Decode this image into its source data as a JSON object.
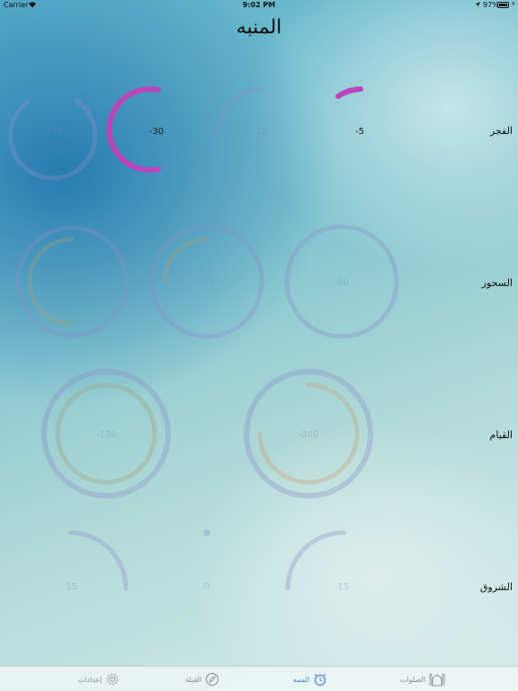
{
  "status_bar": {
    "carrier": "Carrier",
    "time": "9:02 PM",
    "battery": "97%"
  },
  "header": {
    "title": "المنبه"
  },
  "rows": [
    {
      "label": "الفجر",
      "rings": [
        "-45",
        "-30",
        "-15",
        "-5"
      ]
    },
    {
      "label": "السحور",
      "rings": [
        "-90",
        "-25",
        "-60"
      ]
    },
    {
      "label": "القيام",
      "rings": [
        "-120",
        "-300"
      ]
    },
    {
      "label": "الشروق",
      "rings": [
        "15",
        "0",
        "-15"
      ]
    }
  ],
  "tab_bar": {
    "tabs": [
      {
        "label": "إعدادات",
        "icon": "gear-icon"
      },
      {
        "label": "القبلة",
        "icon": "compass-icon"
      },
      {
        "label": "المنبه",
        "icon": "alarm-clock-icon",
        "active": true
      },
      {
        "label": "الصلوات",
        "icon": "mosque-icon"
      }
    ]
  },
  "colors": {
    "accent": "#bb44bb",
    "tab_active": "#3a86d8",
    "faded_ring": "#9aa6cc"
  }
}
